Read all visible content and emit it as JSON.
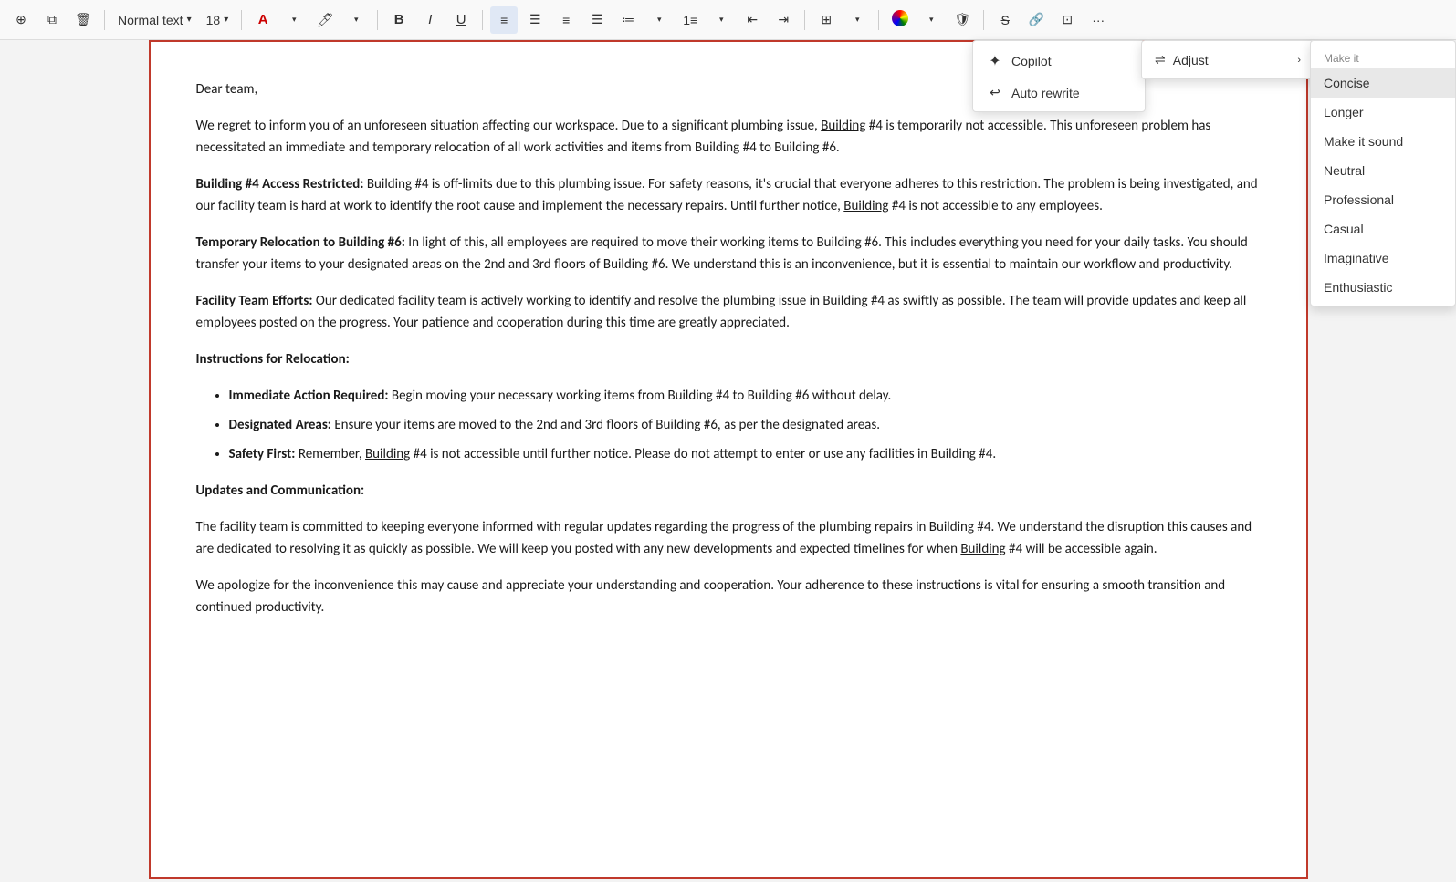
{
  "toolbar": {
    "style_label": "Normal text",
    "font_size": "18",
    "bold_label": "B",
    "italic_label": "I",
    "underline_label": "U",
    "more_options_label": "...",
    "buttons": [
      {
        "name": "add-icon",
        "icon": "+",
        "tooltip": "Add"
      },
      {
        "name": "copy-icon",
        "icon": "⧉",
        "tooltip": "Copy"
      },
      {
        "name": "delete-icon",
        "icon": "🗑",
        "tooltip": "Delete"
      }
    ]
  },
  "copilot_menu": {
    "items": [
      {
        "id": "copilot",
        "label": "Copilot",
        "icon": "✦"
      },
      {
        "id": "auto-rewrite",
        "label": "Auto rewrite",
        "icon": "↩"
      }
    ]
  },
  "adjust_menu": {
    "label": "Adjust",
    "items": [
      {
        "id": "adjust",
        "label": "Adjust",
        "has_arrow": true
      }
    ]
  },
  "make_it_menu": {
    "header": "Make it",
    "items": [
      {
        "id": "concise",
        "label": "Concise",
        "selected": true
      },
      {
        "id": "longer",
        "label": "Longer",
        "selected": false
      },
      {
        "id": "make-it-sound",
        "label": "Make it sound",
        "selected": false
      },
      {
        "id": "neutral",
        "label": "Neutral",
        "selected": false
      },
      {
        "id": "professional",
        "label": "Professional",
        "selected": false
      },
      {
        "id": "casual",
        "label": "Casual",
        "selected": false
      },
      {
        "id": "imaginative",
        "label": "Imaginative",
        "selected": false
      },
      {
        "id": "enthusiastic",
        "label": "Enthusiastic",
        "selected": false
      }
    ]
  },
  "document": {
    "greeting": "Dear team,",
    "paragraph1": "We regret to inform you of an unforeseen situation affecting our workspace. Due to a significant plumbing issue, Building #4 is temporarily not accessible. This unforeseen problem has necessitated an immediate and temporary relocation of all work activities and items from Building #4 to Building #6.",
    "section1_title": "Building #4 Access Restricted:",
    "section1_body": " Building #4 is off-limits due to this plumbing issue. For safety reasons, it's crucial that everyone adheres to this restriction. The problem is being investigated, and our facility team is hard at work to identify the root cause and implement the necessary repairs. Until further notice, Building #4 is not accessible to any employees.",
    "section2_title": "Temporary Relocation to Building #6:",
    "section2_body": " In light of this, all employees are required to move their working items to Building #6. This includes everything you need for your daily tasks. You should transfer your items to your designated areas on the 2nd and 3rd floors of Building #6. We understand this is an inconvenience, but it is essential to maintain our workflow and productivity.",
    "section3_title": "Facility Team Efforts:",
    "section3_body": " Our dedicated facility team is actively working to identify and resolve the plumbing issue in Building #4 as swiftly as possible. The team will provide updates and keep all employees posted on the progress. Your patience and cooperation during this time are greatly appreciated.",
    "instructions_title": "Instructions for Relocation:",
    "bullet1_title": "Immediate Action Required:",
    "bullet1_body": " Begin moving your necessary working items from Building #4 to Building #6 without delay.",
    "bullet2_title": "Designated Areas:",
    "bullet2_body": " Ensure your items are moved to the 2nd and 3rd floors of Building #6, as per the designated areas.",
    "bullet3_title": "Safety First:",
    "bullet3_body": " Remember, Building #4 is not accessible until further notice. Please do not attempt to enter or use any facilities in Building #4.",
    "updates_title": "Updates and Communication:",
    "updates_body": "The facility team is committed to keeping everyone informed with regular updates regarding the progress of the plumbing repairs in Building #4. We understand the disruption this causes and are dedicated to resolving it as quickly as possible. We will keep you posted with any new developments and expected timelines for when Building #4 will be accessible again.",
    "closing": "We apologize for the inconvenience this may cause and appreciate your understanding and cooperation. Your adherence to these instructions is vital for ensuring a smooth transition and continued productivity."
  }
}
